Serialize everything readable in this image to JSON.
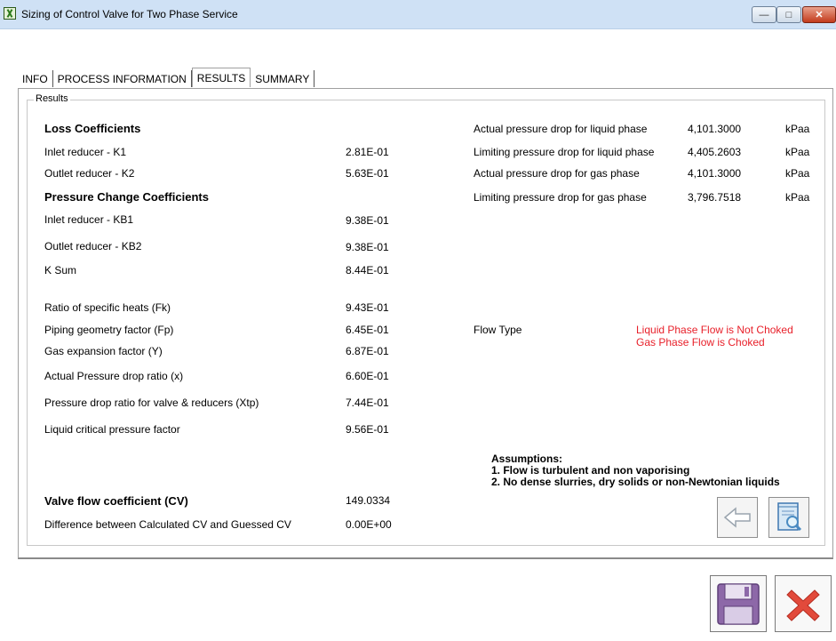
{
  "window": {
    "title": "Sizing of Control Valve for Two Phase Service"
  },
  "tabs": [
    "INFO",
    "PROCESS INFORMATION",
    "RESULTS",
    "SUMMARY"
  ],
  "group": {
    "label": "Results"
  },
  "left": {
    "loss_heading": "Loss Coefficients",
    "k1_label": "Inlet reducer - K1",
    "k1_value": "2.81E-01",
    "k2_label": "Outlet reducer - K2",
    "k2_value": "5.63E-01",
    "pc_heading": "Pressure Change Coefficients",
    "kb1_label": "Inlet reducer - KB1",
    "kb1_value": "9.38E-01",
    "kb2_label": "Outlet reducer - KB2",
    "kb2_value": "9.38E-01",
    "ksum_label": "K Sum",
    "ksum_value": "8.44E-01",
    "fk_label": "Ratio of specific heats (Fk)",
    "fk_value": "9.43E-01",
    "fp_label": "Piping geometry factor (Fp)",
    "fp_value": "6.45E-01",
    "y_label": "Gas expansion factor (Y)",
    "y_value": "6.87E-01",
    "x_label": "Actual Pressure drop ratio (x)",
    "x_value": "6.60E-01",
    "xtp_label": "Pressure drop ratio for valve & reducers (Xtp)",
    "xtp_value": "7.44E-01",
    "lcp_label": "Liquid critical pressure factor",
    "lcp_value": "9.56E-01",
    "cv_label": "Valve flow coefficient (CV)",
    "cv_value": "149.0334",
    "diff_label": "Difference between Calculated CV and Guessed CV",
    "diff_value": "0.00E+00"
  },
  "right": {
    "rows": [
      {
        "label": "Actual pressure drop for liquid phase",
        "value": "4,101.3000",
        "unit": "kPaa"
      },
      {
        "label": "Limiting pressure drop for liquid phase",
        "value": "4,405.2603",
        "unit": "kPaa"
      },
      {
        "label": "Actual pressure drop for gas phase",
        "value": "4,101.3000",
        "unit": "kPaa"
      },
      {
        "label": "Limiting pressure drop for gas phase",
        "value": "3,796.7518",
        "unit": "kPaa"
      }
    ],
    "flow_type_label": "Flow Type",
    "flow_status_liquid": "Liquid Phase Flow is Not Choked",
    "flow_status_gas": "Gas Phase Flow is Choked",
    "assumptions_title": "Assumptions:",
    "assumption_1": "1. Flow is turbulent and non vaporising",
    "assumption_2": "2. No dense slurries, dry solids or non-Newtonian liquids"
  },
  "colors": {
    "status_red": "#e8202a",
    "titlebar": "#cfe1f5",
    "save_purple": "#7e5a9a",
    "cancel_red": "#e24a3b"
  },
  "icons": [
    "app-icon",
    "minimize-icon",
    "maximize-icon",
    "close-icon",
    "back-arrow-icon",
    "report-preview-icon",
    "save-icon",
    "cancel-icon"
  ]
}
